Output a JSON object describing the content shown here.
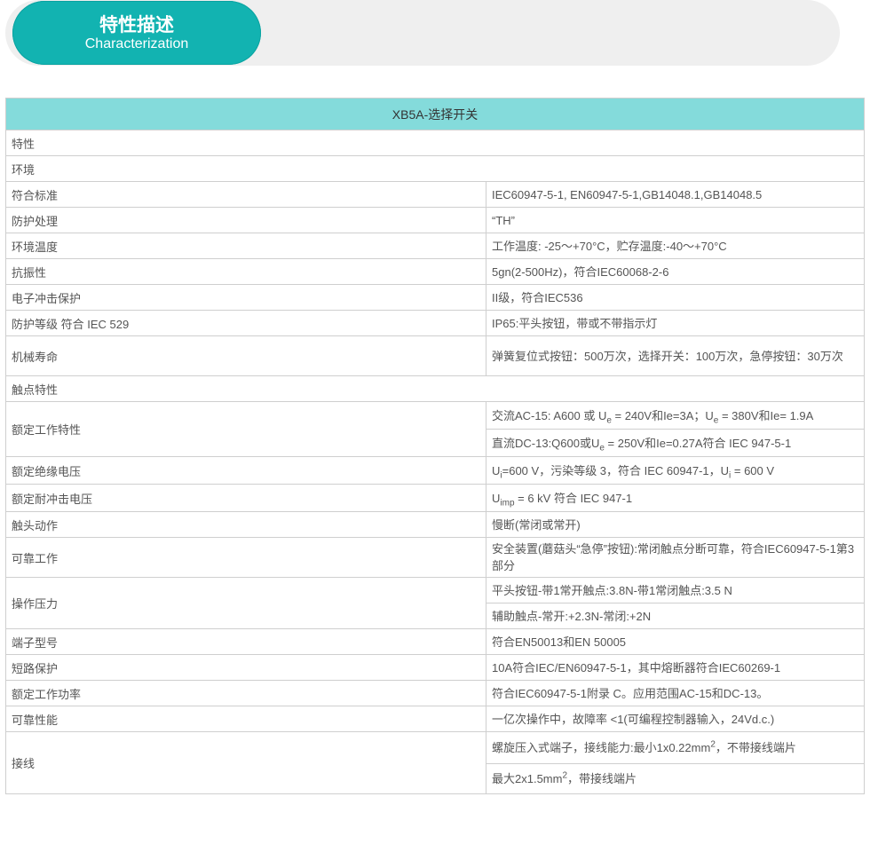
{
  "banner": {
    "title": "特性描述",
    "subtitle": "Characterization"
  },
  "table": {
    "header": "XB5A-选择开关",
    "section_characteristics": "特性",
    "section_environment": "环境",
    "section_contacts": "触点特性",
    "rows": {
      "standard": {
        "label": "符合标准",
        "value": "IEC60947-5-1, EN60947-5-1,GB14048.1,GB14048.5"
      },
      "treatment": {
        "label": "防护处理",
        "value": "“TH”"
      },
      "temperature": {
        "label": "环境温度",
        "value": "工作温度: -25～+70°C，贮存温度:-40～+70°C"
      },
      "vibration": {
        "label": "抗振性",
        "value": "5gn(2-500Hz)，符合IEC60068-2-6"
      },
      "shock": {
        "label": "电子冲击保护",
        "value": "II级，符合IEC536"
      },
      "protection": {
        "label": "防护等级 符合 IEC 529",
        "value": "IP65:平头按钮，带或不带指示灯"
      },
      "mech_life": {
        "label": "机械寿命",
        "value": "弹簧复位式按钮：500万次，选择开关：100万次，急停按钮：30万次"
      },
      "rated_op": {
        "label": "额定工作特性",
        "ac_a": "交流AC-15: A600 或 U",
        "ac_sub1": "e",
        "ac_b": " = 240V和Ie=3A；U",
        "ac_sub2": "e",
        "ac_c": " = 380V和Ie= 1.9A",
        "dc_a": "直流DC-13:Q600或U",
        "dc_sub": "e",
        "dc_b": " = 250V和Ie=0.27A符合 IEC 947-5-1"
      },
      "insulation": {
        "label": "额定绝缘电压",
        "a": "U",
        "sub1": "i",
        "b": "=600 V，污染等级 3，符合 IEC 60947-1，U",
        "sub2": "i",
        "c": " = 600 V"
      },
      "impulse": {
        "label": "额定耐冲击电压",
        "a": "U",
        "sub": "imp",
        "b": " = 6 kV 符合 IEC 947-1"
      },
      "action": {
        "label": "触头动作",
        "value": "慢断(常闭或常开)"
      },
      "reliable": {
        "label": "可靠工作",
        "value": "安全装置(蘑菇头“急停”按钮):常闭触点分断可靠，符合IEC60947-5-1第3部分"
      },
      "force": {
        "label": "操作压力",
        "line1": "平头按钮-带1常开触点:3.8N-带1常闭触点:3.5 N",
        "line2": "辅助触点-常开:+2.3N-常闭:+2N"
      },
      "terminal": {
        "label": "端子型号",
        "value": "符合EN50013和EN 50005"
      },
      "short": {
        "label": "短路保护",
        "value": "10A符合IEC/EN60947-5-1，其中熔断器符合IEC60269-1"
      },
      "power": {
        "label": "额定工作功率",
        "value": "符合IEC60947-5-1附录 C。应用范围AC-15和DC-13。"
      },
      "reliability": {
        "label": "可靠性能",
        "value": "一亿次操作中，故障率 <1(可编程控制器输入，24Vd.c.)"
      },
      "wiring": {
        "label": "接线",
        "line1_a": "螺旋压入式端子，接线能力:最小1x0.22mm",
        "line1_sup": "2",
        "line1_b": "，不带接线端片",
        "line2_a": "最大2x1.5mm",
        "line2_sup": "2",
        "line2_b": "，带接线端片"
      }
    }
  }
}
